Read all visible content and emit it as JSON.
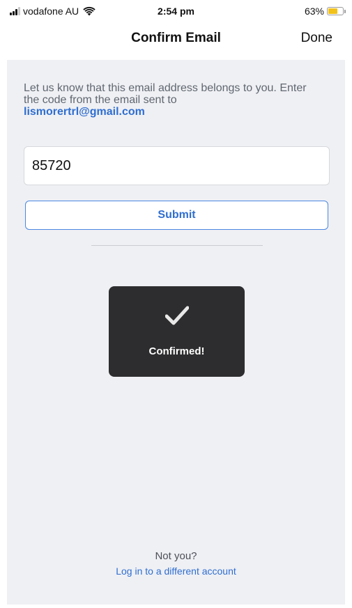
{
  "status_bar": {
    "carrier": "vodafone AU",
    "time": "2:54 pm",
    "battery_percent": "63%",
    "battery_level": 0.63,
    "signal_bars": 3,
    "signal_bars_total": 4,
    "icons": [
      "cellular-signal-icon",
      "wifi-icon",
      "battery-icon"
    ],
    "battery_color": "#f2c21b"
  },
  "nav": {
    "title": "Confirm Email",
    "done_label": "Done"
  },
  "confirm": {
    "intro_text": "Let us know that this email address belongs to you. Enter the code from the email sent to",
    "email": "lismorertrl@gmail.com",
    "code_value": "85720",
    "submit_label": "Submit"
  },
  "toast": {
    "icon": "checkmark-icon",
    "message": "Confirmed!"
  },
  "footer": {
    "not_you": "Not you?",
    "switch_account_link": "Log in to a different account"
  },
  "colors": {
    "accent": "#2f6ed0",
    "background": "#eff0f4",
    "toast_background": "#2d2d2f"
  }
}
